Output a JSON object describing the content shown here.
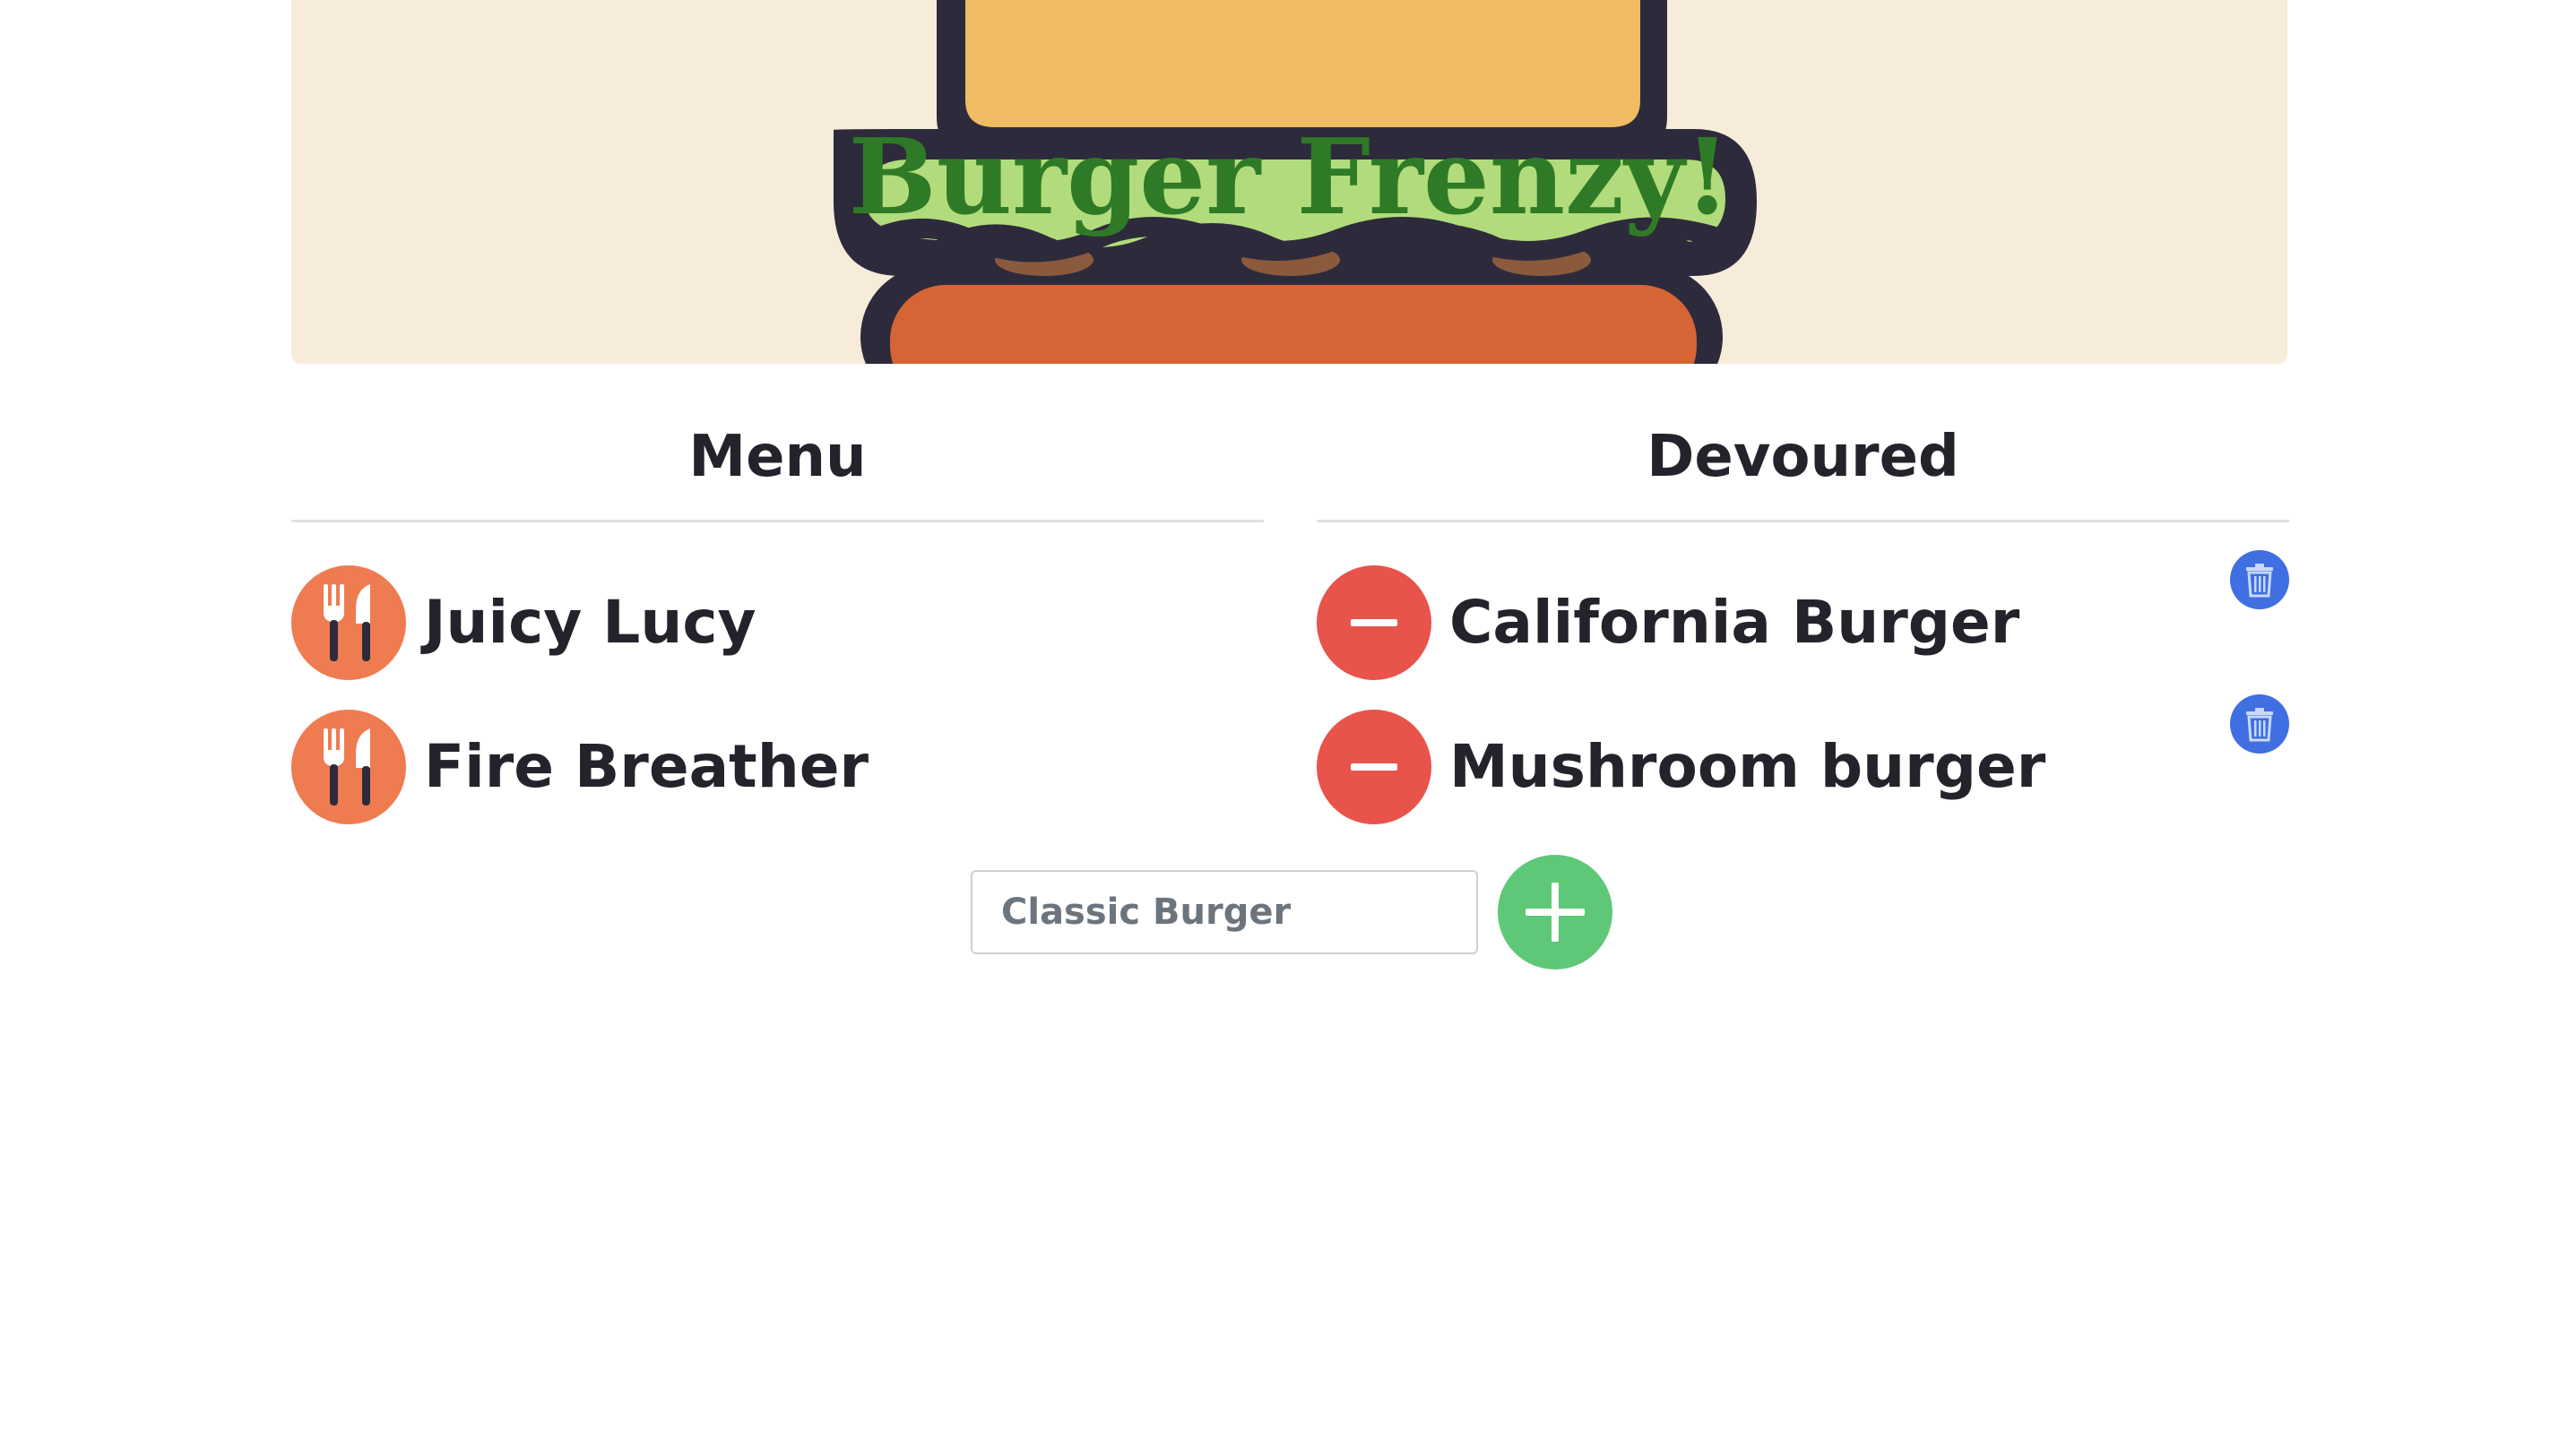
{
  "header": {
    "title": "Burger Frenzy!",
    "logo_icon": "burger-illustration"
  },
  "menu": {
    "heading": "Menu",
    "action_icon": "fork-knife-icon",
    "items": [
      {
        "name": "Juicy Lucy"
      },
      {
        "name": "Fire Breather"
      }
    ]
  },
  "devoured": {
    "heading": "Devoured",
    "action_icon": "minus-icon",
    "delete_icon": "trash-icon",
    "items": [
      {
        "name": "California Burger"
      },
      {
        "name": "Mushroom burger"
      }
    ]
  },
  "add_form": {
    "placeholder": "Classic Burger",
    "value": "",
    "submit_icon": "plus-icon"
  },
  "colors": {
    "banner_bg": "#f7ebda",
    "title": "#2f7a26",
    "bun_top": "#efbb63",
    "lettuce": "#b2dc7b",
    "patty": "#d56535",
    "outline": "#2d2b3b",
    "eat_button": "#ef7b50",
    "remove_button": "#e8534b",
    "delete_button": "#3f6fe0",
    "add_button": "#5fc878"
  }
}
